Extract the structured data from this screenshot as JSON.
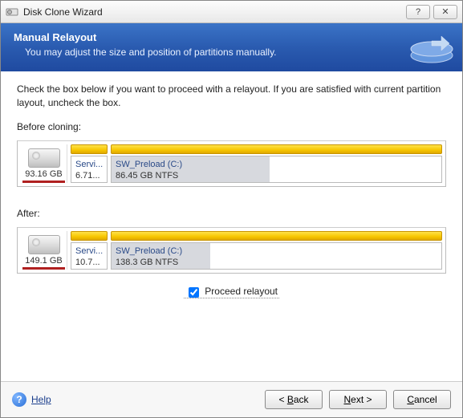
{
  "window": {
    "title": "Disk Clone Wizard"
  },
  "banner": {
    "heading": "Manual Relayout",
    "subtext": "You may adjust the size and position of partitions manually."
  },
  "instruction": "Check the box below if you want to proceed with a relayout. If you are satisfied with current partition layout, uncheck the box.",
  "labels": {
    "before": "Before cloning:",
    "after": "After:"
  },
  "before": {
    "disk_size": "93.16 GB",
    "p1": {
      "name": "Servi...",
      "size": "6.71..."
    },
    "p2": {
      "name": "SW_Preload (C:)",
      "size": "86.45 GB  NTFS"
    }
  },
  "after": {
    "disk_size": "149.1 GB",
    "p1": {
      "name": "Servi...",
      "size": "10.7..."
    },
    "p2": {
      "name": "SW_Preload (C:)",
      "size": "138.3 GB  NTFS"
    }
  },
  "checkbox": {
    "label": "Proceed relayout",
    "checked": true
  },
  "buttons": {
    "back": "< Back",
    "next": "Next >",
    "cancel": "Cancel",
    "help": "Help"
  }
}
